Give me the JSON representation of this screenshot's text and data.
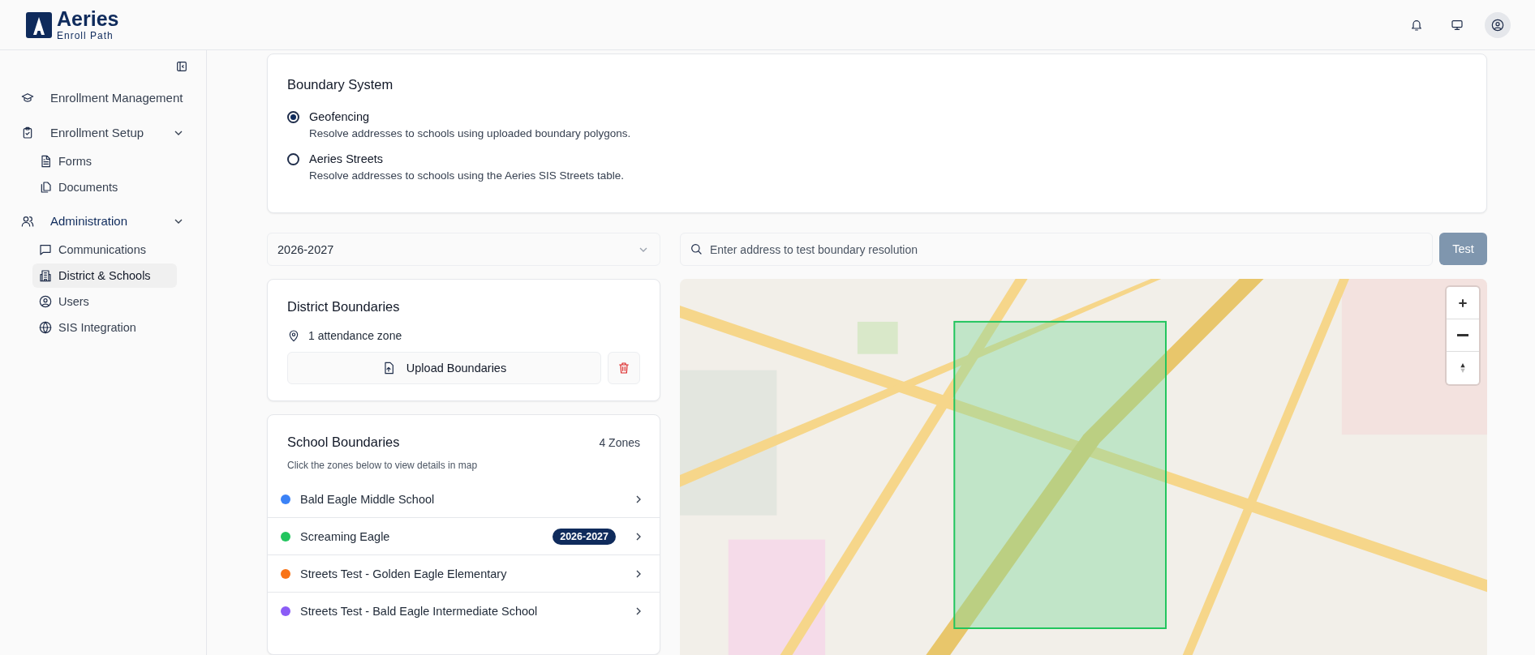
{
  "header": {
    "logo_title": "Aeries",
    "logo_subtitle": "Enroll Path"
  },
  "sidebar": {
    "items": [
      {
        "label": "Enrollment Management",
        "kind": "link",
        "selected": false
      },
      {
        "label": "Enrollment Setup",
        "kind": "group",
        "selected": false,
        "expanded": true,
        "children": [
          {
            "label": "Forms",
            "selected": false
          },
          {
            "label": "Documents",
            "selected": false
          }
        ]
      },
      {
        "label": "Administration",
        "kind": "group",
        "selected": true,
        "expanded": true,
        "children": [
          {
            "label": "Communications",
            "selected": false
          },
          {
            "label": "District & Schools",
            "selected": true
          },
          {
            "label": "Users",
            "selected": false
          },
          {
            "label": "SIS Integration",
            "selected": false
          }
        ]
      }
    ]
  },
  "boundary_system": {
    "title": "Boundary System",
    "options": [
      {
        "label": "Geofencing",
        "description": "Resolve addresses to schools using uploaded boundary polygons.",
        "selected": true
      },
      {
        "label": "Aeries Streets",
        "description": "Resolve addresses to schools using the Aeries SIS Streets table.",
        "selected": false
      }
    ]
  },
  "year_select": {
    "value": "2026-2027"
  },
  "address_search": {
    "placeholder": "Enter address to test boundary resolution"
  },
  "test_button": {
    "label": "Test",
    "disabled": true
  },
  "district_boundaries": {
    "title": "District Boundaries",
    "zone_count": "1 attendance zone",
    "upload_button": "Upload Boundaries"
  },
  "school_boundaries": {
    "title": "School Boundaries",
    "count": "4 Zones",
    "hint": "Click the zones below to view details in map",
    "zones": [
      {
        "name": "Bald Eagle Middle School",
        "color": "#3b82f6"
      },
      {
        "name": "Screaming Eagle",
        "color": "#22c55e",
        "badge": "2026-2027"
      },
      {
        "name": "Streets Test - Golden Eagle Elementary",
        "color": "#f97316"
      },
      {
        "name": "Streets Test - Bald Eagle Intermediate School",
        "color": "#8b5cf6"
      }
    ]
  }
}
